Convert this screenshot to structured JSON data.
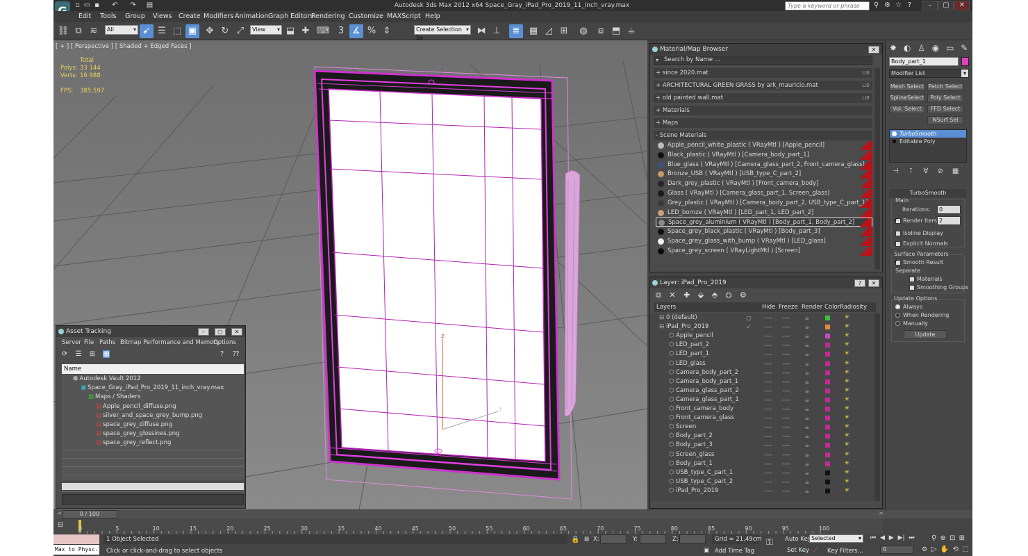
{
  "window": {
    "title": "Autodesk 3ds Max  2012 x64      Space_Gray_iPad_Pro_2019_11_inch_vray.max",
    "help_search_placeholder": "Type a keyword or phrase",
    "logo": "G"
  },
  "menu": [
    "Edit",
    "Tools",
    "Group",
    "Views",
    "Create",
    "Modifiers",
    "Animation",
    "Graph Editors",
    "Rendering",
    "Customize",
    "MAXScript",
    "Help"
  ],
  "toolbar": {
    "selection_filter": "All",
    "ref_coord": "View",
    "named_selection": "Create Selection Se",
    "snap_label": "3"
  },
  "viewport": {
    "label": "[ + ] [ Perspective ] [ Shaded + Edged Faces ]",
    "stats": {
      "total_label": "Total",
      "polys_label": "Polys:",
      "polys_value": "33 144",
      "verts_label": "Verts:",
      "verts_value": "16 988",
      "fps_label": "FPS:",
      "fps_value": "385,597"
    },
    "axis_z": "z",
    "axis_y": "y"
  },
  "material_browser": {
    "title": "Material/Map Browser",
    "search_placeholder": "Search by Name ...",
    "lib_tag": "LIB",
    "categories": [
      {
        "label": "+ since 2020.mat",
        "lib": true
      },
      {
        "label": "+ ARCHITECTURAL GREEN GRASS by ark_mauricio.mat",
        "lib": true
      },
      {
        "label": "+ old painted wall.mat",
        "lib": true
      },
      {
        "label": "+ Materials",
        "lib": false
      },
      {
        "label": "+ Maps",
        "lib": false
      },
      {
        "label": "- Scene Materials",
        "lib": false
      }
    ],
    "scene_materials": [
      {
        "name": "Apple_pencil_white_plastic  ( VRayMtl ) [Apple_pencil]",
        "color": "#bdbdbd",
        "selected": false
      },
      {
        "name": "Black_plastic  ( VRayMtl ) [Camera_body_part_1]",
        "color": "#111111",
        "selected": false
      },
      {
        "name": "Blue_glass  ( VRayMtl ) [Camera_glass_part_2, Front_camera_glass]",
        "color": "#3c5478",
        "selected": false
      },
      {
        "name": "Bronze_USB  ( VRayMtl ) [USB_type_C_part_2]",
        "color": "#c89a6a",
        "selected": false
      },
      {
        "name": "Dark_grey_plastic  ( VRayMtl ) [Front_camera_body]",
        "color": "#262626",
        "selected": false
      },
      {
        "name": "Glass  ( VRayMtl ) [Camera_glass_part_1, Screen_glass]",
        "color": "#1a1a1a",
        "selected": false
      },
      {
        "name": "Grey_plastic  ( VRayMtl ) [Camera_body_part_2, USB_type_C_part_1]",
        "color": "#3a3a3a",
        "selected": false
      },
      {
        "name": "LED_bornze  ( VRayMtl ) [LED_part_1, LED_part_2]",
        "color": "#c8a27a",
        "selected": false
      },
      {
        "name": "Space_grey_aluminium  ( VRayMtl ) [Body_part_1, Body_part_2]",
        "color": "#8a8a8a",
        "selected": true
      },
      {
        "name": "Space_grey_black_plastic  ( VRayMtl ) [Body_part_3]",
        "color": "#101010",
        "selected": false
      },
      {
        "name": "Space_grey_glass_with_bump  ( VRayMtl ) [LED_glass]",
        "color": "#f0f0f0",
        "selected": false
      },
      {
        "name": "Space_grey_screen  ( VRayLightMtl ) [Screen]",
        "color": "#0c0c0c",
        "selected": false
      }
    ]
  },
  "layer_panel": {
    "title": "Layer: iPad_Pro_2019",
    "columns": {
      "layers": "Layers",
      "hide": "Hide",
      "freeze": "Freeze",
      "render": "Render",
      "color": "Color",
      "radiosity": "Radiosity"
    },
    "dash": "----",
    "layers": [
      {
        "name": "0 (default)",
        "indent": 1,
        "color": "#3cc03c"
      },
      {
        "name": "iPad_Pro_2019",
        "indent": 1,
        "color": "#e08a3c"
      },
      {
        "name": "Apple_pencil",
        "indent": 2,
        "color": "#c84ac8"
      },
      {
        "name": "LED_part_2",
        "indent": 2,
        "color": "#c8289a"
      },
      {
        "name": "LED_part_1",
        "indent": 2,
        "color": "#c8289a"
      },
      {
        "name": "LED_glass",
        "indent": 2,
        "color": "#c8289a"
      },
      {
        "name": "Camera_body_part_2",
        "indent": 2,
        "color": "#c8289a"
      },
      {
        "name": "Camera_body_part_1",
        "indent": 2,
        "color": "#c8289a"
      },
      {
        "name": "Camera_glass_part_2",
        "indent": 2,
        "color": "#c8289a"
      },
      {
        "name": "Camera_glass_part_1",
        "indent": 2,
        "color": "#c8289a"
      },
      {
        "name": "Front_camera_body",
        "indent": 2,
        "color": "#c8289a"
      },
      {
        "name": "Front_camera_glass",
        "indent": 2,
        "color": "#c8289a"
      },
      {
        "name": "Screen",
        "indent": 2,
        "color": "#c8289a"
      },
      {
        "name": "Body_part_2",
        "indent": 2,
        "color": "#c8289a"
      },
      {
        "name": "Body_part_3",
        "indent": 2,
        "color": "#c8289a"
      },
      {
        "name": "Screen_glass",
        "indent": 2,
        "color": "#c8289a"
      },
      {
        "name": "Body_part_1",
        "indent": 2,
        "color": "#c8289a"
      },
      {
        "name": "USB_type_C_part_1",
        "indent": 2,
        "color": "#111111"
      },
      {
        "name": "USB_type_C_part_2",
        "indent": 2,
        "color": "#111111"
      },
      {
        "name": "iPad_Pro_2019",
        "indent": 2,
        "color": "#111111"
      }
    ]
  },
  "command_panel": {
    "object_name": "Body_part_1",
    "object_color": "#e040c0",
    "modifier_list": "Modifier List",
    "buttons": [
      "Mesh Select",
      "Patch Select",
      "SplineSelect",
      "Poly Select",
      "Vol. Select",
      "FFD Select",
      "NSurf Sel"
    ],
    "stack": [
      "TurboSmooth",
      "Editable Poly"
    ],
    "rollout_title": "TurboSmooth",
    "main_label": "Main",
    "iterations_label": "Iterations:",
    "iterations_value": "0",
    "render_iters_label": "Render Iters:",
    "render_iters_value": "2",
    "isoline": "Isoline Display",
    "explicit": "Explicit Normals",
    "surface_params": "Surface Parameters",
    "smooth_result": "Smooth Result",
    "separate": "Separate",
    "materials": "Materials",
    "smoothing_groups": "Smoothing Groups",
    "update_options": "Update Options",
    "always": "Always",
    "when_rendering": "When Rendering",
    "manually": "Manually",
    "update_button": "Update"
  },
  "asset_tracking": {
    "title": "Asset Tracking",
    "menu": [
      "Server",
      "File",
      "Paths",
      "Bitmap Performance and Memory",
      "Options"
    ],
    "column_name": "Name",
    "rows": [
      {
        "label": "Autodesk Vault 2012",
        "indent": 0
      },
      {
        "label": "Space_Gray_iPad_Pro_2019_11_inch_vray.max",
        "indent": 1
      },
      {
        "label": "Maps / Shaders",
        "indent": 2
      },
      {
        "label": "Apple_pencil_diffuse.png",
        "indent": 3
      },
      {
        "label": "silver_and_space_grey_bump.png",
        "indent": 3
      },
      {
        "label": "space_grey_diffuse.png",
        "indent": 3
      },
      {
        "label": "space_grey_glossines.png",
        "indent": 3
      },
      {
        "label": "space_grey_reflect.png",
        "indent": 3
      }
    ]
  },
  "timeline": {
    "frame_label": "0 / 100",
    "ticks": [
      "0",
      "5",
      "10",
      "15",
      "20",
      "25",
      "30",
      "35",
      "40",
      "45",
      "50",
      "55",
      "60",
      "65",
      "70",
      "75",
      "80",
      "85",
      "90",
      "95",
      "100"
    ]
  },
  "status": {
    "maxscript": "Max to Physc.",
    "objects_selected": "1 Object Selected",
    "prompt": "Click or click-and-drag to select objects",
    "x_label": "X:",
    "y_label": "Y:",
    "z_label": "Z:",
    "grid": "Grid = 21,49cm",
    "add_time_tag": "Add Time Tag",
    "auto_key": "Auto Key",
    "set_key": "Set Key",
    "selected": "Selected",
    "key_filters": "Key Filters...",
    "frame_value": "0"
  }
}
